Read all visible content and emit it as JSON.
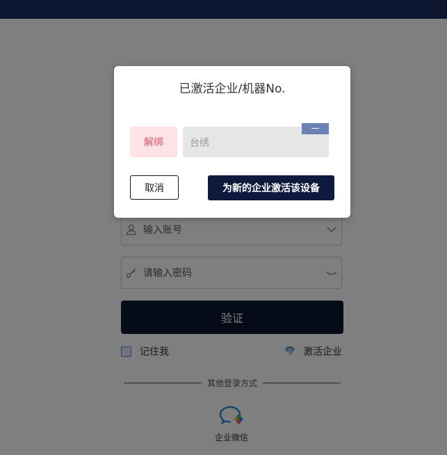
{
  "login": {
    "account_placeholder": "输入账号",
    "password_placeholder": "请输入密码",
    "verify_label": "验证",
    "remember_label": "记住我",
    "activate_label": "激活企业",
    "other_login_label": "其他登录方式",
    "wecom_label": "企业微信"
  },
  "modal": {
    "title": "已激活企业/机器No.",
    "unbind_label": "解绑",
    "company_name": "台绣",
    "minus_label": "—",
    "cancel_label": "取消",
    "activate_new_label": "为新的企业激活该设备"
  },
  "colors": {
    "topbar": "#0d1630",
    "primary": "#0d1a3d",
    "danger_text": "#e0566a",
    "danger_bg": "#fde3e6",
    "minus_bg": "#6b82b5"
  }
}
